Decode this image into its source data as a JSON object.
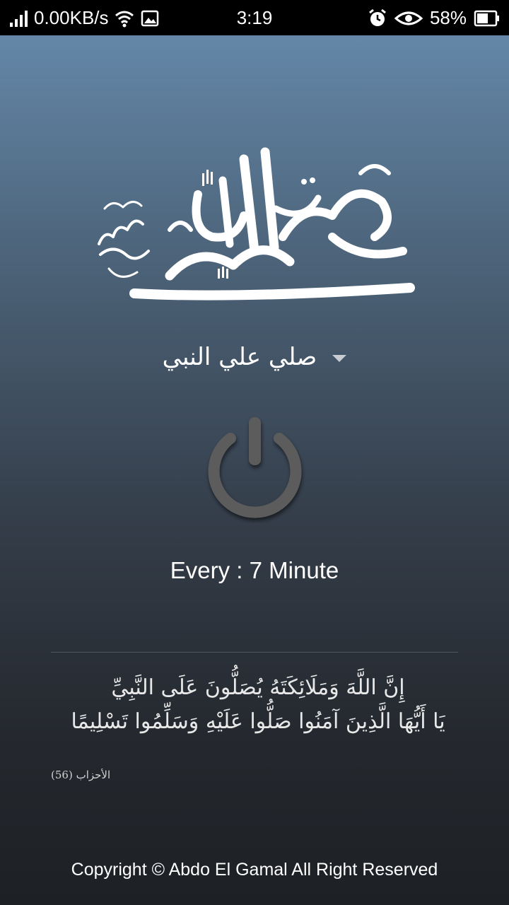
{
  "status_bar": {
    "network_speed": "0.00KB/s",
    "time": "3:19",
    "battery_percent": "58%",
    "icons": [
      "signal-icon",
      "wifi-icon",
      "image-icon",
      "alarm-icon",
      "eye-icon",
      "battery-icon"
    ]
  },
  "app": {
    "calligraphy_icon": "muhammad-rasulullah-calligraphy",
    "selector": {
      "selected_value": "صلي علي النبي",
      "icon": "dropdown-arrow-icon"
    },
    "power_icon": "power-icon",
    "interval_text": "Every : 7 Minute",
    "verse": {
      "line1": "إِنَّ اللَّهَ وَمَلَائِكَتَهُ يُصَلُّونَ عَلَى النَّبِيِّ",
      "line2": "يَا أَيُّهَا الَّذِينَ آمَنُوا صَلُّوا عَلَيْهِ وَسَلِّمُوا تَسْلِيمًا",
      "reference": "الأحزاب (56)"
    },
    "copyright": "Copyright © Abdo El Gamal All Right Reserved"
  }
}
